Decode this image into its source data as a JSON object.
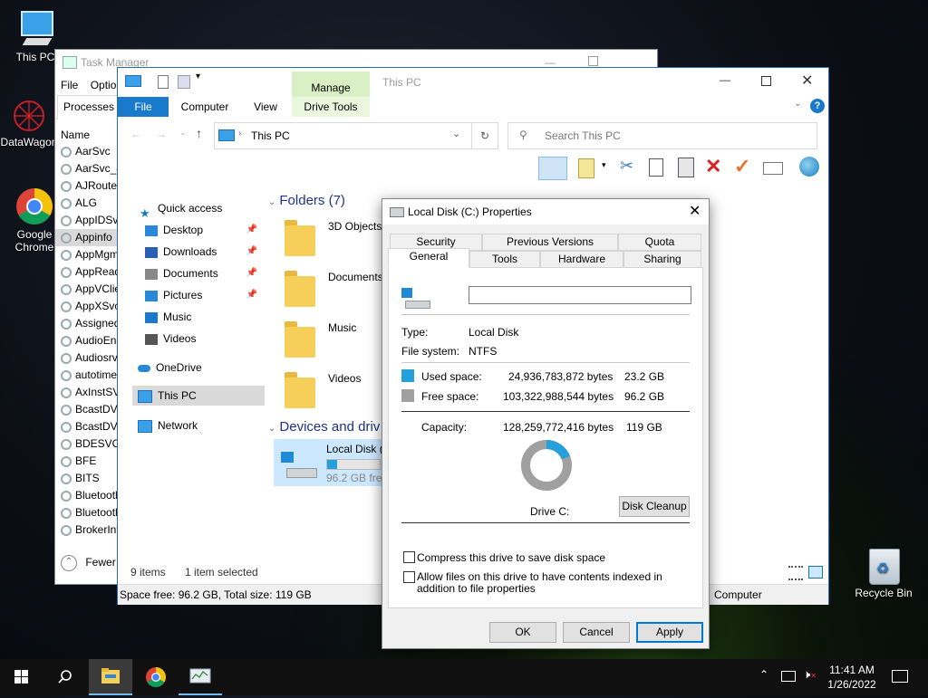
{
  "desktop": {
    "icons": [
      {
        "label": "This PC"
      },
      {
        "label": "DataWagon"
      },
      {
        "label": "Google Chrome"
      },
      {
        "label": "Recycle Bin"
      }
    ]
  },
  "task_manager": {
    "title": "Task Manager",
    "menu": [
      "File",
      "Optio"
    ],
    "tab": "Processes",
    "column": "Name",
    "processes": [
      "AarSvc",
      "AarSvc_4",
      "AJRouter",
      "ALG",
      "AppIDSvc",
      "Appinfo",
      "AppMgm",
      "AppRead",
      "AppVClie",
      "AppXSvc",
      "Assigned",
      "AudioEnd",
      "Audiosrv",
      "autotime",
      "AxInstSV",
      "BcastDVR",
      "BcastDVR",
      "BDESVC",
      "BFE",
      "BITS",
      "Bluetooth",
      "Bluetooth",
      "BrokerInf"
    ],
    "fewer_details": "Fewer"
  },
  "explorer": {
    "title": "This PC",
    "ribbon": {
      "manage": "Manage",
      "file": "File",
      "computer": "Computer",
      "view": "View",
      "drive_tools": "Drive Tools"
    },
    "address": "This PC",
    "search_placeholder": "Search This PC",
    "nav": {
      "quick_access": "Quick access",
      "items": [
        {
          "label": "Desktop",
          "pinned": true
        },
        {
          "label": "Downloads",
          "pinned": true
        },
        {
          "label": "Documents",
          "pinned": true
        },
        {
          "label": "Pictures",
          "pinned": true
        },
        {
          "label": "Music",
          "pinned": false
        },
        {
          "label": "Videos",
          "pinned": false
        }
      ],
      "onedrive": "OneDrive",
      "this_pc": "This PC",
      "network": "Network"
    },
    "folders_header": "Folders (7)",
    "folders": [
      "3D Objects",
      "Documents",
      "Music",
      "Videos"
    ],
    "devices_header": "Devices and drives (1)",
    "drive": {
      "name": "Local Disk (C:)",
      "free": "96.2 GB free of 119 GB",
      "used_fraction": 0.19
    },
    "status": {
      "items": "9 items",
      "selected": "1 item selected"
    },
    "details_bar": {
      "space": "Space free: 96.2 GB, Total size: 119 GB",
      "computer": "Computer"
    }
  },
  "dialog": {
    "title": "Local Disk (C:) Properties",
    "tabs_row1": [
      "Security",
      "Previous Versions",
      "Quota"
    ],
    "tabs_row2": [
      "General",
      "Tools",
      "Hardware",
      "Sharing"
    ],
    "active_tab": "General",
    "label_value": "",
    "type_label": "Type:",
    "type_value": "Local Disk",
    "fs_label": "File system:",
    "fs_value": "NTFS",
    "used_label": "Used space:",
    "used_bytes": "24,936,783,872 bytes",
    "used_gb": "23.2 GB",
    "free_label": "Free space:",
    "free_bytes": "103,322,988,544 bytes",
    "free_gb": "96.2 GB",
    "capacity_label": "Capacity:",
    "capacity_bytes": "128,259,772,416 bytes",
    "capacity_gb": "119 GB",
    "drive_label": "Drive C:",
    "disk_cleanup": "Disk Cleanup",
    "compress": "Compress this drive to save disk space",
    "index": "Allow files on this drive to have contents indexed in addition to file properties",
    "ok": "OK",
    "cancel": "Cancel",
    "apply": "Apply",
    "colors": {
      "used": "#26a0da",
      "free": "#a0a0a0"
    }
  },
  "taskbar": {
    "time": "11:41 AM",
    "date": "1/26/2022"
  }
}
